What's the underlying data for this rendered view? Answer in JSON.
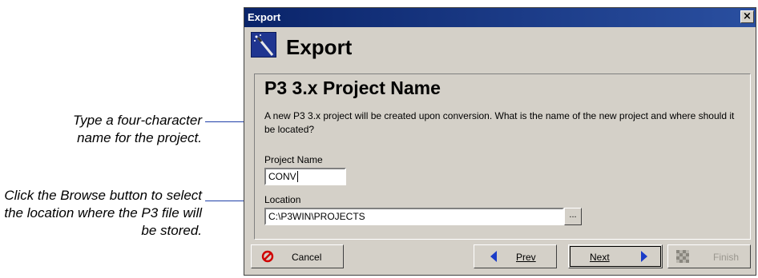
{
  "callouts": {
    "project_name_hint": "Type a four-character name for the project.",
    "browse_hint": "Click the Browse button to select the location where the P3 file will be stored."
  },
  "window": {
    "title": "Export",
    "close_glyph": "×",
    "header_title": "Export",
    "header_icon": "wand-icon"
  },
  "panel": {
    "title": "P3 3.x Project Name",
    "description": "A new P3 3.x project will be created upon conversion.  What is the name of the new project and where should it be located?"
  },
  "project_name": {
    "label": "Project Name",
    "value": "CONV"
  },
  "location": {
    "label": "Location",
    "value": "C:\\P3WIN\\PROJECTS",
    "browse_label": "..."
  },
  "buttons": {
    "cancel": "Cancel",
    "prev": "Prev",
    "next": "Next",
    "finish": "Finish"
  },
  "colors": {
    "titlebar": "#0a246a",
    "dialog_bg": "#d4d0c8",
    "leader_line": "#1f3fa8",
    "nav_arrow": "#1a3cc8",
    "cancel_icon": "#d00000"
  }
}
